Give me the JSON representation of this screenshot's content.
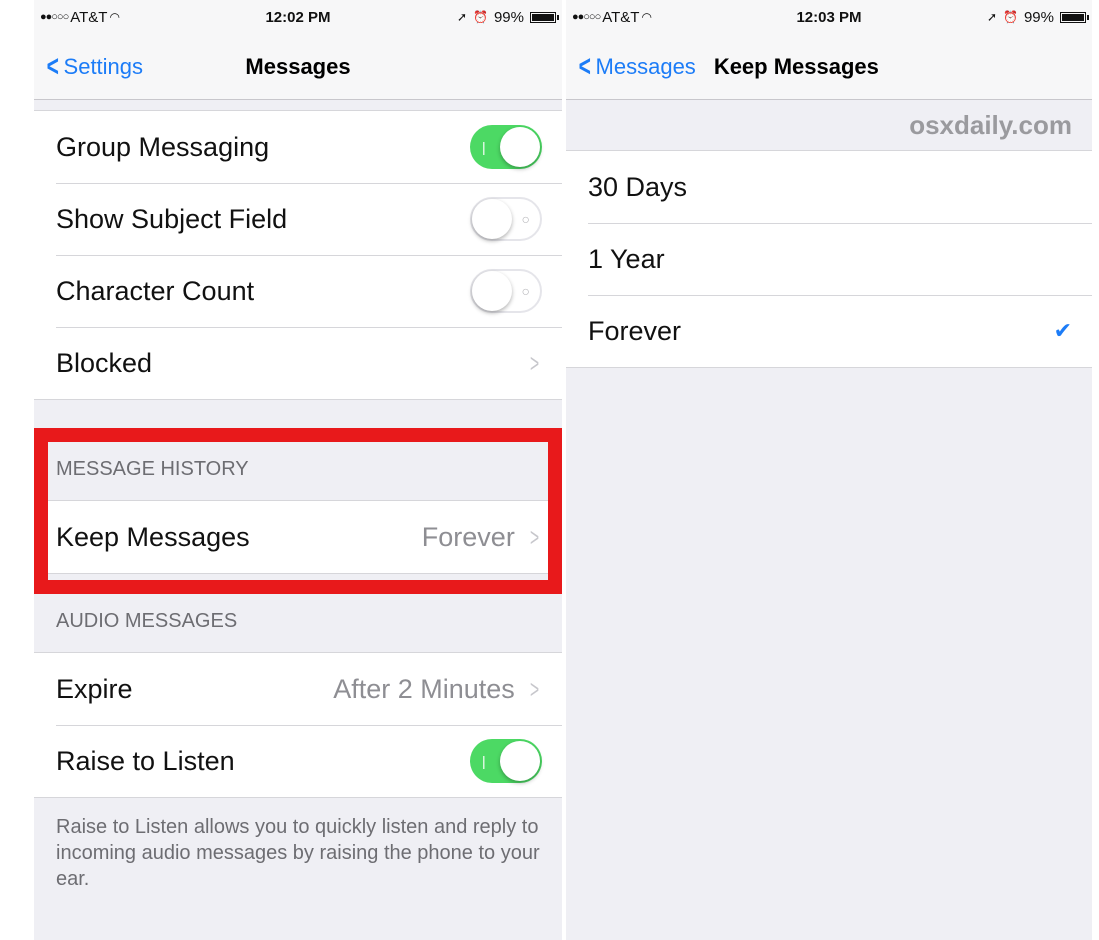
{
  "left_screen": {
    "status_bar": {
      "carrier": "AT&T",
      "time": "12:02 PM",
      "battery": "99%"
    },
    "nav": {
      "back_label": "Settings",
      "title": "Messages"
    },
    "rows": [
      {
        "label": "Group Messaging",
        "toggle": "on"
      },
      {
        "label": "Show Subject Field",
        "toggle": "off"
      },
      {
        "label": "Character Count",
        "toggle": "off"
      },
      {
        "label": "Blocked"
      }
    ],
    "message_history": {
      "header": "MESSAGE HISTORY",
      "row": {
        "label": "Keep Messages",
        "value": "Forever"
      }
    },
    "audio_messages": {
      "header": "AUDIO MESSAGES",
      "rows": [
        {
          "label": "Expire",
          "value": "After 2 Minutes"
        },
        {
          "label": "Raise to Listen",
          "toggle": "on"
        }
      ],
      "footer": "Raise to Listen allows you to quickly listen and reply to incoming audio messages by raising the phone to your ear."
    }
  },
  "right_screen": {
    "status_bar": {
      "carrier": "AT&T",
      "time": "12:03 PM",
      "battery": "99%"
    },
    "nav": {
      "back_label": "Messages",
      "title": "Keep Messages"
    },
    "watermark": "osxdaily.com",
    "options": [
      {
        "label": "30 Days",
        "selected": false
      },
      {
        "label": "1 Year",
        "selected": false
      },
      {
        "label": "Forever",
        "selected": true
      }
    ]
  },
  "colors": {
    "highlight": "#e8191b",
    "ios_blue": "#1c7cf7",
    "toggle_on": "#4cd964"
  }
}
